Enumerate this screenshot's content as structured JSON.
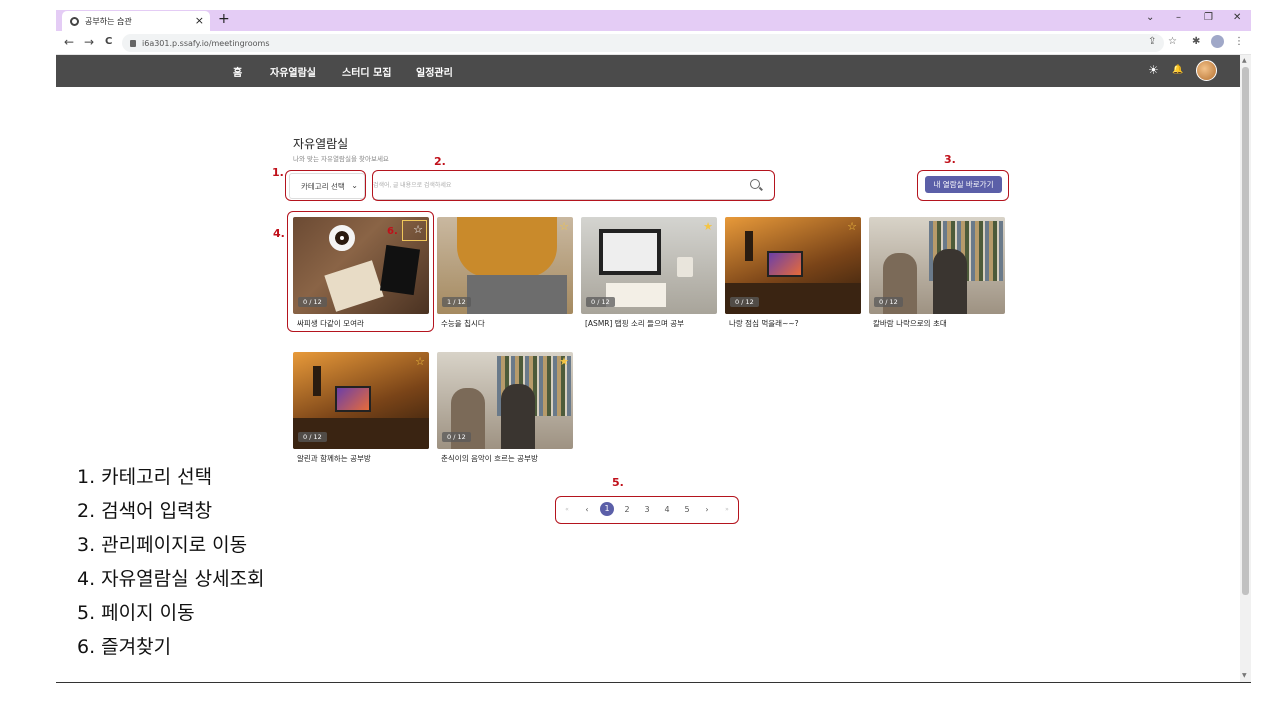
{
  "browser": {
    "tab_title": "공부하는 습관",
    "tab_close": "×",
    "new_tab": "+",
    "url": "i6a301.p.ssafy.io/meetingrooms",
    "back": "←",
    "forward": "→",
    "reload": "C",
    "win_collapse": "⌄",
    "win_min": "–",
    "win_restore": "❐",
    "win_close": "✕",
    "share_icon": "⇪",
    "bookmark_icon": "☆",
    "extension_icon": "✱",
    "menu_icon": "⋮"
  },
  "nav": {
    "items": [
      "홈",
      "자유열람실",
      "스터디 모집",
      "일정관리"
    ],
    "theme_icon": "☀",
    "bell_icon": "🔔"
  },
  "page": {
    "title": "자유열람실",
    "subtitle": "나와 맞는 자유열람실을 찾아보세요",
    "category_label": "카테고리 선택",
    "category_chevron": "⌄",
    "search_placeholder": "검색어, 글 내용으로 검색하세요",
    "my_room_button": "내 열람실 바로가기"
  },
  "rooms": [
    {
      "title": "싸피생 다같이 모여라",
      "count": "0 / 12",
      "star": "☆"
    },
    {
      "title": "수능을 칩시다",
      "count": "1 / 12",
      "star": "☆"
    },
    {
      "title": "[ASMR] 탭핑 소리 들으며 공부",
      "count": "0 / 12",
      "star": "★"
    },
    {
      "title": "나랑 점심 먹을래~~?",
      "count": "0 / 12",
      "star": "☆"
    },
    {
      "title": "칼바람 나락으로의 초대",
      "count": "0 / 12",
      "star": ""
    },
    {
      "title": "알린과 함께하는 공부방",
      "count": "0 / 12",
      "star": "☆"
    },
    {
      "title": "춘식이의 음악이 흐르는 공부방",
      "count": "0 / 12",
      "star": "★"
    }
  ],
  "pagination": {
    "first": "«",
    "prev": "‹",
    "pages": [
      "1",
      "2",
      "3",
      "4",
      "5"
    ],
    "current": 1,
    "next": "›",
    "last": "»"
  },
  "annotations": {
    "markers": [
      "1.",
      "2.",
      "3.",
      "4.",
      "5.",
      "6."
    ],
    "legend": [
      "1. 카테고리 선택",
      "2. 검색어 입력창",
      "3. 관리페이지로 이동",
      "4. 자유열람실 상세조회",
      "5. 페이지 이동",
      "6. 즐겨찾기"
    ]
  },
  "colors": {
    "nav_bg": "#4b4b4b",
    "accent": "#5b5fa8",
    "annotation_red": "#c0101a",
    "tabbar_bg": "#e4ccf5",
    "star": "#f5c542"
  }
}
